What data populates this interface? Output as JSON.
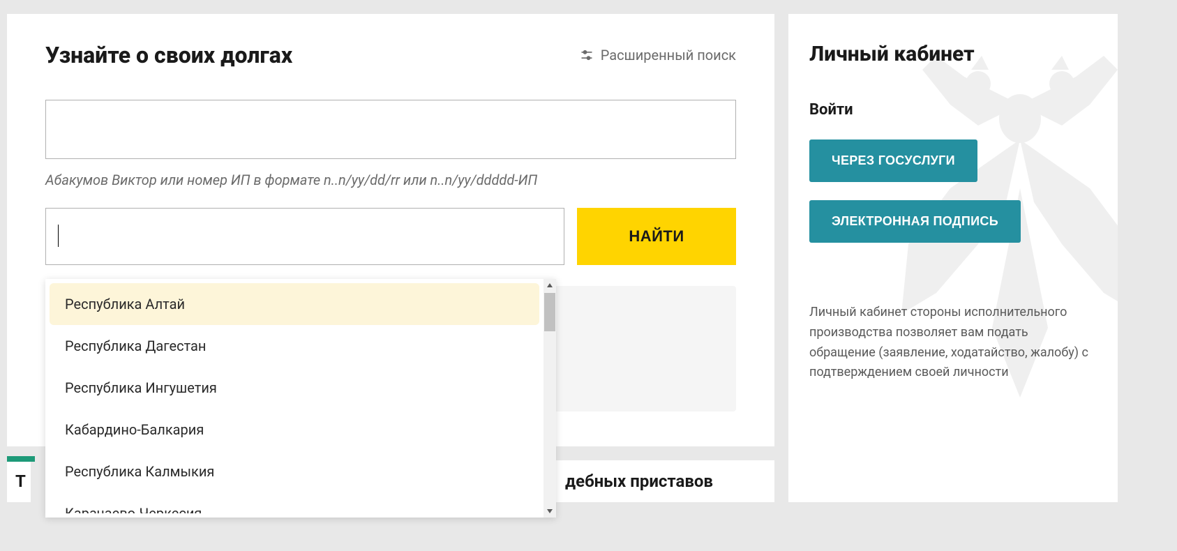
{
  "main": {
    "title": "Узнайте о своих долгах",
    "advanced_search": "Расширенный поиск",
    "hint": "Абакумов Виктор или номер ИП в формате n..n/yy/dd/rr или n..n/yy/ddddd-ИП",
    "find_button": "НАЙТИ"
  },
  "dropdown": {
    "items": [
      "Республика Алтай",
      "Республика Дагестан",
      "Республика Ингушетия",
      "Кабардино-Балкария",
      "Республика Калмыкия",
      "Карачаево-Черкесия"
    ],
    "selected_index": 0
  },
  "tabs": {
    "left_char": "Т",
    "right_fragment": "дебных приставов"
  },
  "sidebar": {
    "title": "Личный кабинет",
    "login_label": "Войти",
    "gosuslugi_button": "ЧЕРЕЗ ГОСУСЛУГИ",
    "signature_button": "ЭЛЕКТРОННАЯ ПОДПИСЬ",
    "description": "Личный кабинет стороны исполнительного производства позволяет вам подать обращение (заявление, ходатайство, жалобу) с подтверждением своей личности"
  },
  "colors": {
    "accent_yellow": "#ffd400",
    "accent_teal": "#2590a0",
    "accent_green": "#1d9a78"
  }
}
